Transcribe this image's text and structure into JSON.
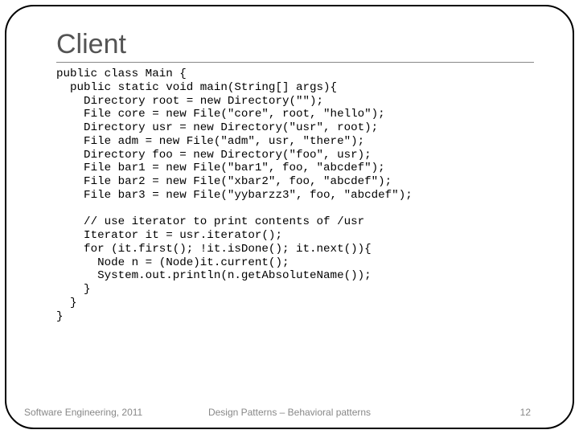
{
  "title": "Client",
  "code": "public class Main {\n  public static void main(String[] args){\n    Directory root = new Directory(\"\");\n    File core = new File(\"core\", root, \"hello\");\n    Directory usr = new Directory(\"usr\", root);\n    File adm = new File(\"adm\", usr, \"there\");\n    Directory foo = new Directory(\"foo\", usr);\n    File bar1 = new File(\"bar1\", foo, \"abcdef\");\n    File bar2 = new File(\"xbar2\", foo, \"abcdef\");\n    File bar3 = new File(\"yybarzz3\", foo, \"abcdef\");\n\n    // use iterator to print contents of /usr\n    Iterator it = usr.iterator();\n    for (it.first(); !it.isDone(); it.next()){\n      Node n = (Node)it.current();\n      System.out.println(n.getAbsoluteName());\n    }\n  }\n}",
  "footer": {
    "left": "Software Engineering, 2011",
    "center": "Design Patterns – Behavioral patterns",
    "right": "12"
  }
}
